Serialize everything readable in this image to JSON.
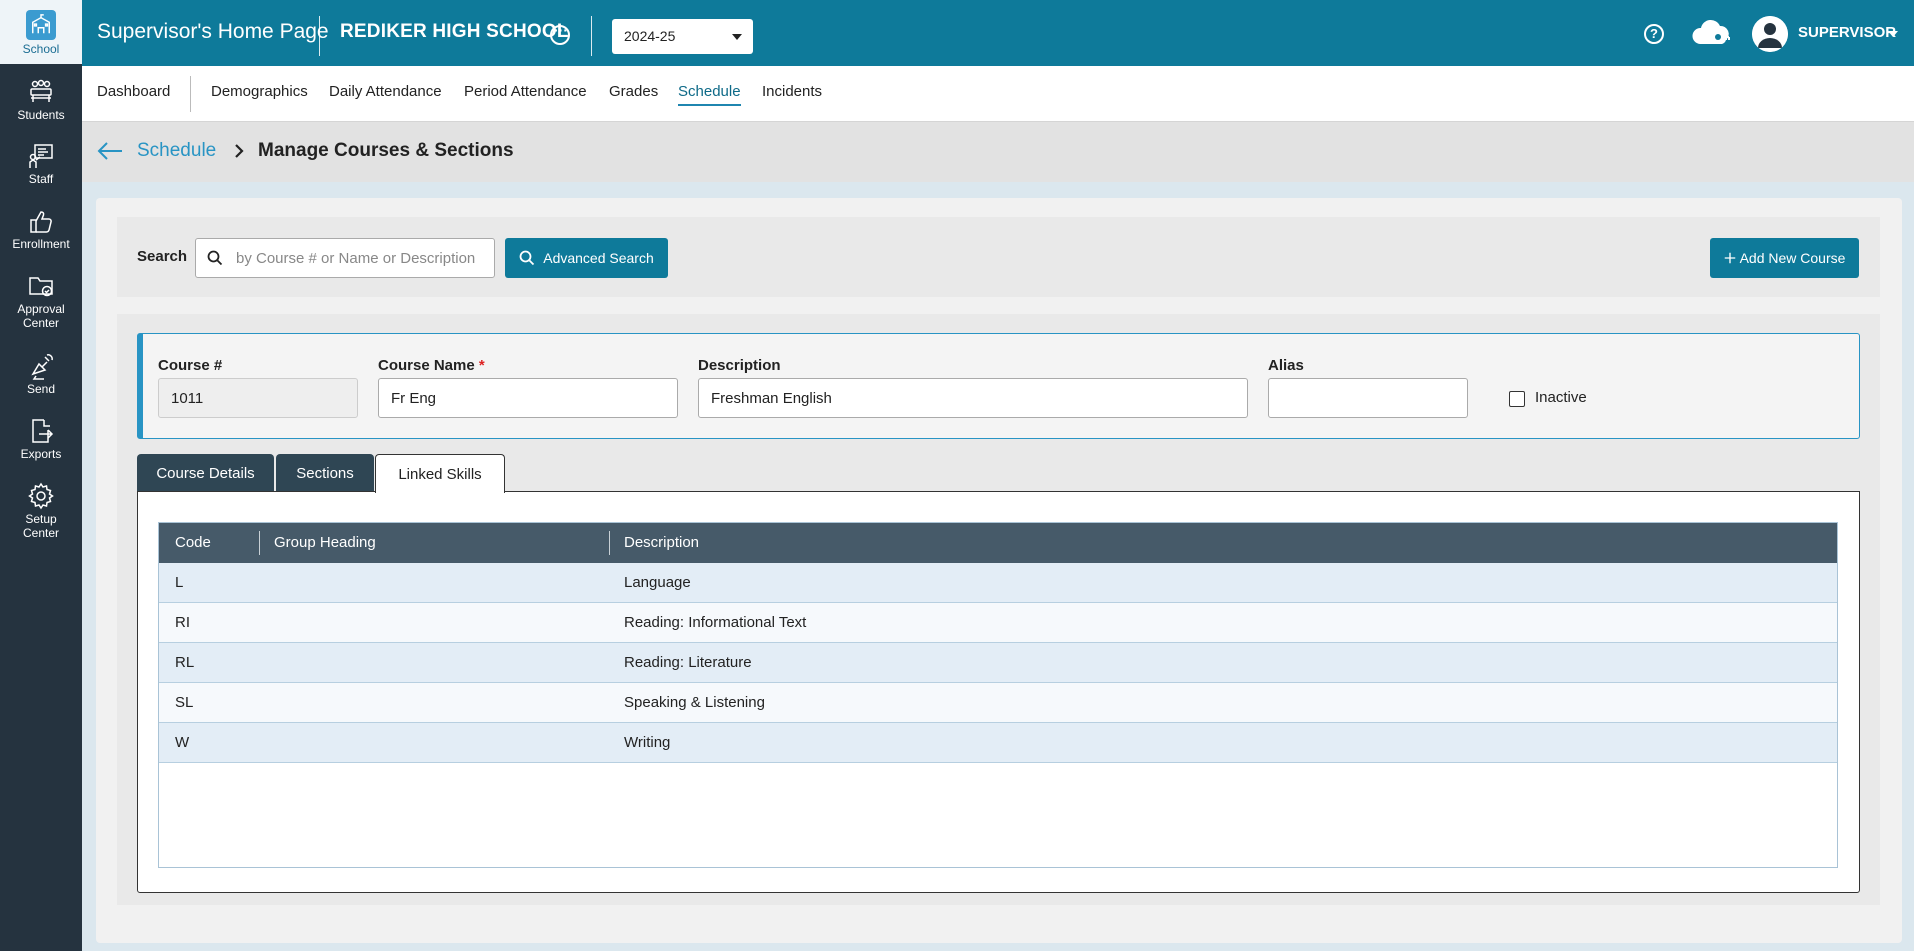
{
  "rail": [
    {
      "label": "School",
      "icon": "school-icon"
    },
    {
      "label": "Students",
      "icon": "students-icon"
    },
    {
      "label": "Staff",
      "icon": "staff-icon"
    },
    {
      "label": "Enrollment",
      "icon": "enrollment-icon"
    },
    {
      "label_l1": "Approval",
      "label_l2": "Center",
      "icon": "approval-center-icon"
    },
    {
      "label": "Send",
      "icon": "send-icon"
    },
    {
      "label": "Exports",
      "icon": "exports-icon"
    },
    {
      "label_l1": "Setup",
      "label_l2": "Center",
      "icon": "setup-center-icon"
    }
  ],
  "topbar": {
    "title": "Supervisor's Home Page",
    "school": "REDIKER HIGH SCHOOL",
    "year": "2024-25",
    "user": "SUPERVISOR",
    "help": "?"
  },
  "nav": {
    "dashboard": "Dashboard",
    "items": [
      "Demographics",
      "Daily Attendance",
      "Period Attendance",
      "Grades",
      "Schedule",
      "Incidents"
    ],
    "active": "Schedule"
  },
  "breadcrumb": {
    "parent": "Schedule",
    "current": "Manage Courses & Sections"
  },
  "search": {
    "label": "Search",
    "placeholder": "by Course # or Name or Description",
    "advanced": "Advanced Search",
    "add_course": "Add New Course"
  },
  "course": {
    "number_label": "Course #",
    "number": "1011",
    "name_label": "Course Name",
    "required_mark": "*",
    "name": "Fr Eng",
    "description_label": "Description",
    "description": "Freshman English",
    "alias_label": "Alias",
    "alias": "",
    "inactive_label": "Inactive",
    "inactive": false
  },
  "tabs": [
    "Course Details",
    "Sections",
    "Linked Skills"
  ],
  "active_tab": "Linked Skills",
  "skills": {
    "columns": [
      "Code",
      "Group Heading",
      "Description"
    ],
    "rows": [
      {
        "code": "L",
        "group": "",
        "description": "Language"
      },
      {
        "code": "RI",
        "group": "",
        "description": "Reading: Informational Text"
      },
      {
        "code": "RL",
        "group": "",
        "description": "Reading: Literature"
      },
      {
        "code": "SL",
        "group": "",
        "description": "Speaking & Listening"
      },
      {
        "code": "W",
        "group": "",
        "description": "Writing"
      }
    ]
  },
  "colors": {
    "topbar": "#0e7a9a",
    "rail": "#25333f",
    "accent": "#2894c4",
    "grid_header": "#465a69"
  }
}
